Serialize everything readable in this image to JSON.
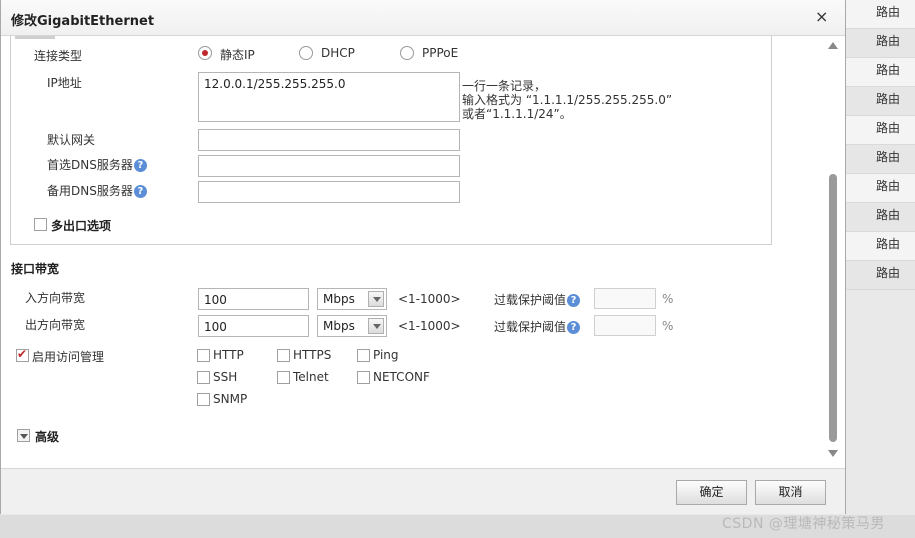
{
  "background_list": {
    "items": [
      "路由",
      "路由",
      "路由",
      "路由",
      "路由",
      "路由",
      "路由",
      "路由",
      "路由",
      "路由"
    ]
  },
  "watermark": "CSDN @理塘神秘策马男",
  "dialog": {
    "title": "修改GigabitEthernet",
    "close_symbol": "×",
    "connection": {
      "type_label": "连接类型",
      "options": [
        "静态IP",
        "DHCP",
        "PPPoE"
      ],
      "selected": "静态IP",
      "ip_label": "IP地址",
      "ip_value": "12.0.0.1/255.255.255.0",
      "ip_hint": [
        "一行一条记录，",
        "输入格式为 “1.1.1.1/255.255.255.0”",
        "或者“1.1.1.1/24”。"
      ],
      "gateway_label": "默认网关",
      "gateway_value": "",
      "dns1_label": "首选DNS服务器",
      "dns1_value": "",
      "dns2_label": "备用DNS服务器",
      "dns2_value": "",
      "help_symbol": "?",
      "multi_exit_label": "多出口选项",
      "multi_exit_checked": false
    },
    "bandwidth": {
      "section_title": "接口带宽",
      "in_label": "入方向带宽",
      "in_value": "100",
      "in_unit": "Mbps",
      "in_range": "<1-1000>",
      "out_label": "出方向带宽",
      "out_value": "100",
      "out_unit": "Mbps",
      "out_range": "<1-1000>",
      "overload_label": "过载保护阈值",
      "percent_symbol": "%"
    },
    "access": {
      "label": "启用访问管理",
      "enabled": true,
      "protocols": [
        "HTTP",
        "HTTPS",
        "Ping",
        "SSH",
        "Telnet",
        "NETCONF",
        "SNMP"
      ]
    },
    "advanced_label": "高级",
    "buttons": {
      "ok": "确定",
      "cancel": "取消"
    }
  },
  "colors": {
    "accent": "#c0292b",
    "help": "#5b8ed6"
  }
}
